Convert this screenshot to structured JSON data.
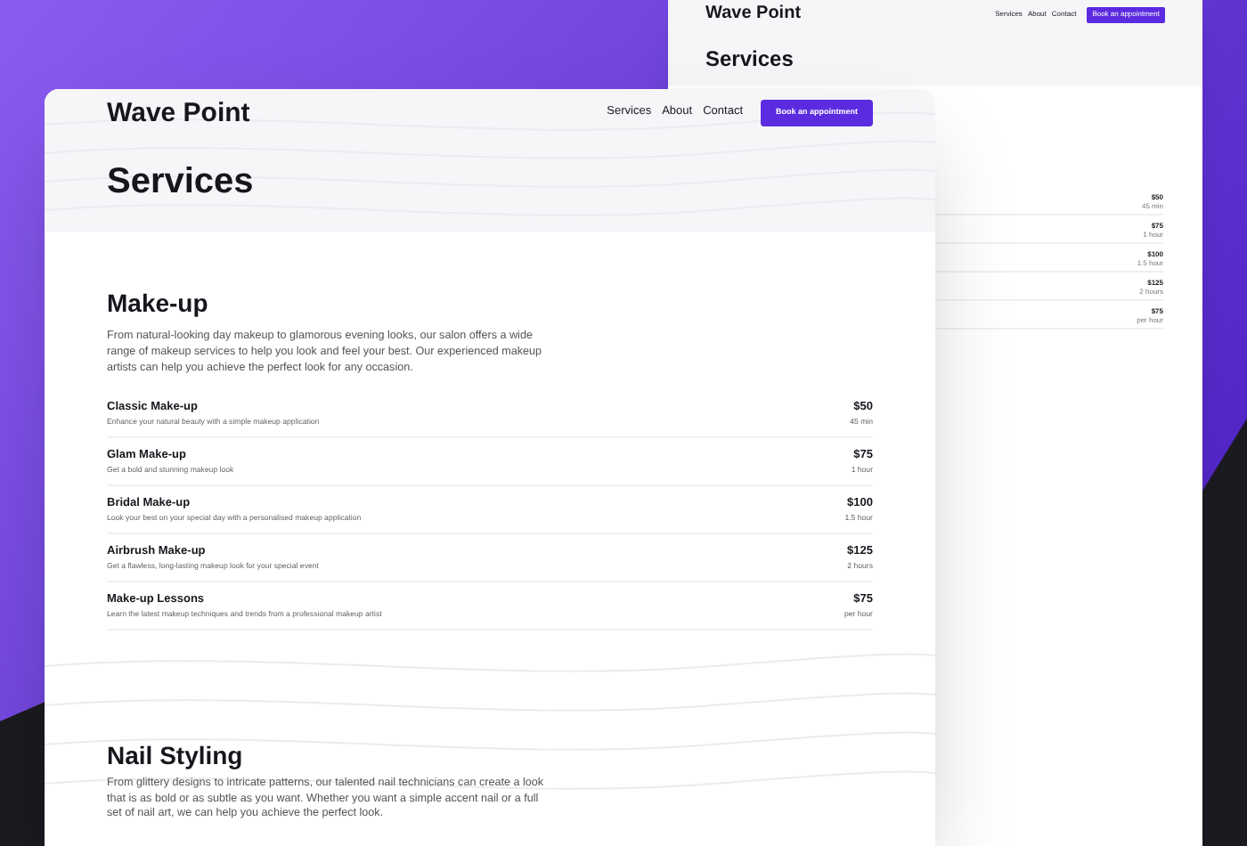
{
  "back_page": {
    "logo": "Wave Point",
    "nav": [
      "Services",
      "About",
      "Contact"
    ],
    "cta": "Book an appointment",
    "title": "Services",
    "prices": [
      {
        "price": "$50",
        "duration": "45 min"
      },
      {
        "price": "$75",
        "duration": "1 hour"
      },
      {
        "price": "$100",
        "duration": "1.5 hour"
      },
      {
        "price": "$125",
        "duration": "2 hours"
      },
      {
        "price": "$75",
        "duration": "per hour"
      }
    ]
  },
  "front_page": {
    "logo": "Wave Point",
    "nav": [
      "Services",
      "About",
      "Contact"
    ],
    "cta": "Book an appointment",
    "title": "Services",
    "sections": [
      {
        "heading": "Make-up",
        "description": "From natural-looking day makeup to glamorous evening looks, our salon offers a wide range of makeup services to help you look and feel your best. Our experienced makeup artists can help you achieve the perfect look for any occasion.",
        "services": [
          {
            "name": "Classic Make-up",
            "description": "Enhance your natural beauty with a simple makeup application",
            "price": "$50",
            "duration": "45 min"
          },
          {
            "name": "Glam Make-up",
            "description": "Get a bold and stunning makeup look",
            "price": "$75",
            "duration": "1 hour"
          },
          {
            "name": "Bridal Make-up",
            "description": "Look your best on your special day with a personalised makeup application",
            "price": "$100",
            "duration": "1.5 hour"
          },
          {
            "name": "Airbrush Make-up",
            "description": "Get a flawless, long-lasting makeup look for your special event",
            "price": "$125",
            "duration": "2 hours"
          },
          {
            "name": "Make-up Lessons",
            "description": "Learn the latest makeup techniques and trends from a professional makeup artist",
            "price": "$75",
            "duration": "per hour"
          }
        ]
      },
      {
        "heading": "Nail Styling",
        "description": "From glittery designs to intricate patterns, our talented nail technicians can create a look that is as bold or as subtle as you want. Whether you want a simple accent nail or a full set of nail art, we can help you achieve the perfect look."
      }
    ]
  }
}
